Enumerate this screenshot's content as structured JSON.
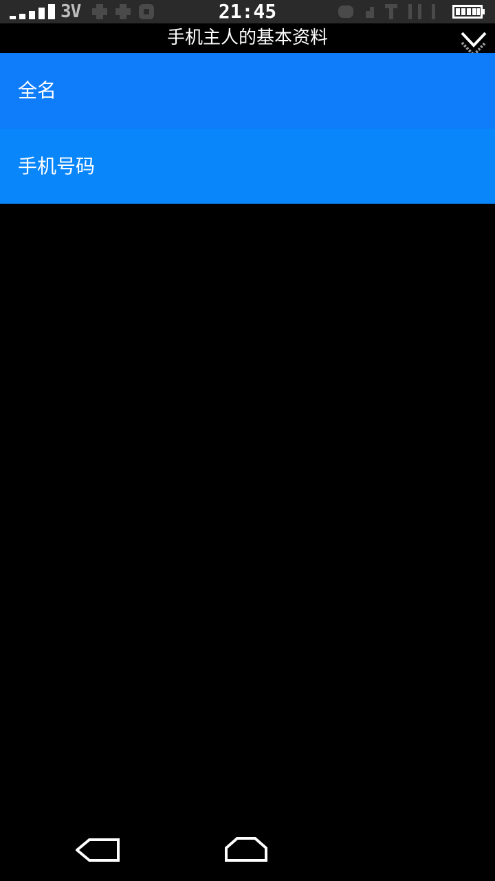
{
  "status_bar": {
    "network_type": "3V",
    "time": "21:45",
    "signal_icon": "signal-bars-icon",
    "battery_icon": "battery-full-icon"
  },
  "header": {
    "title": "手机主人的基本资料",
    "collapse_icon": "chevron-double-down-icon"
  },
  "list": {
    "items": [
      {
        "label": "全名",
        "color": "#0f7dfa"
      },
      {
        "label": "手机号码",
        "color": "#0a86fb"
      }
    ]
  },
  "nav_bar": {
    "back_icon": "back-arrow-icon",
    "home_icon": "home-icon"
  },
  "colors": {
    "background": "#000000",
    "status_bar": "#2a2a2a",
    "text": "#ffffff"
  }
}
